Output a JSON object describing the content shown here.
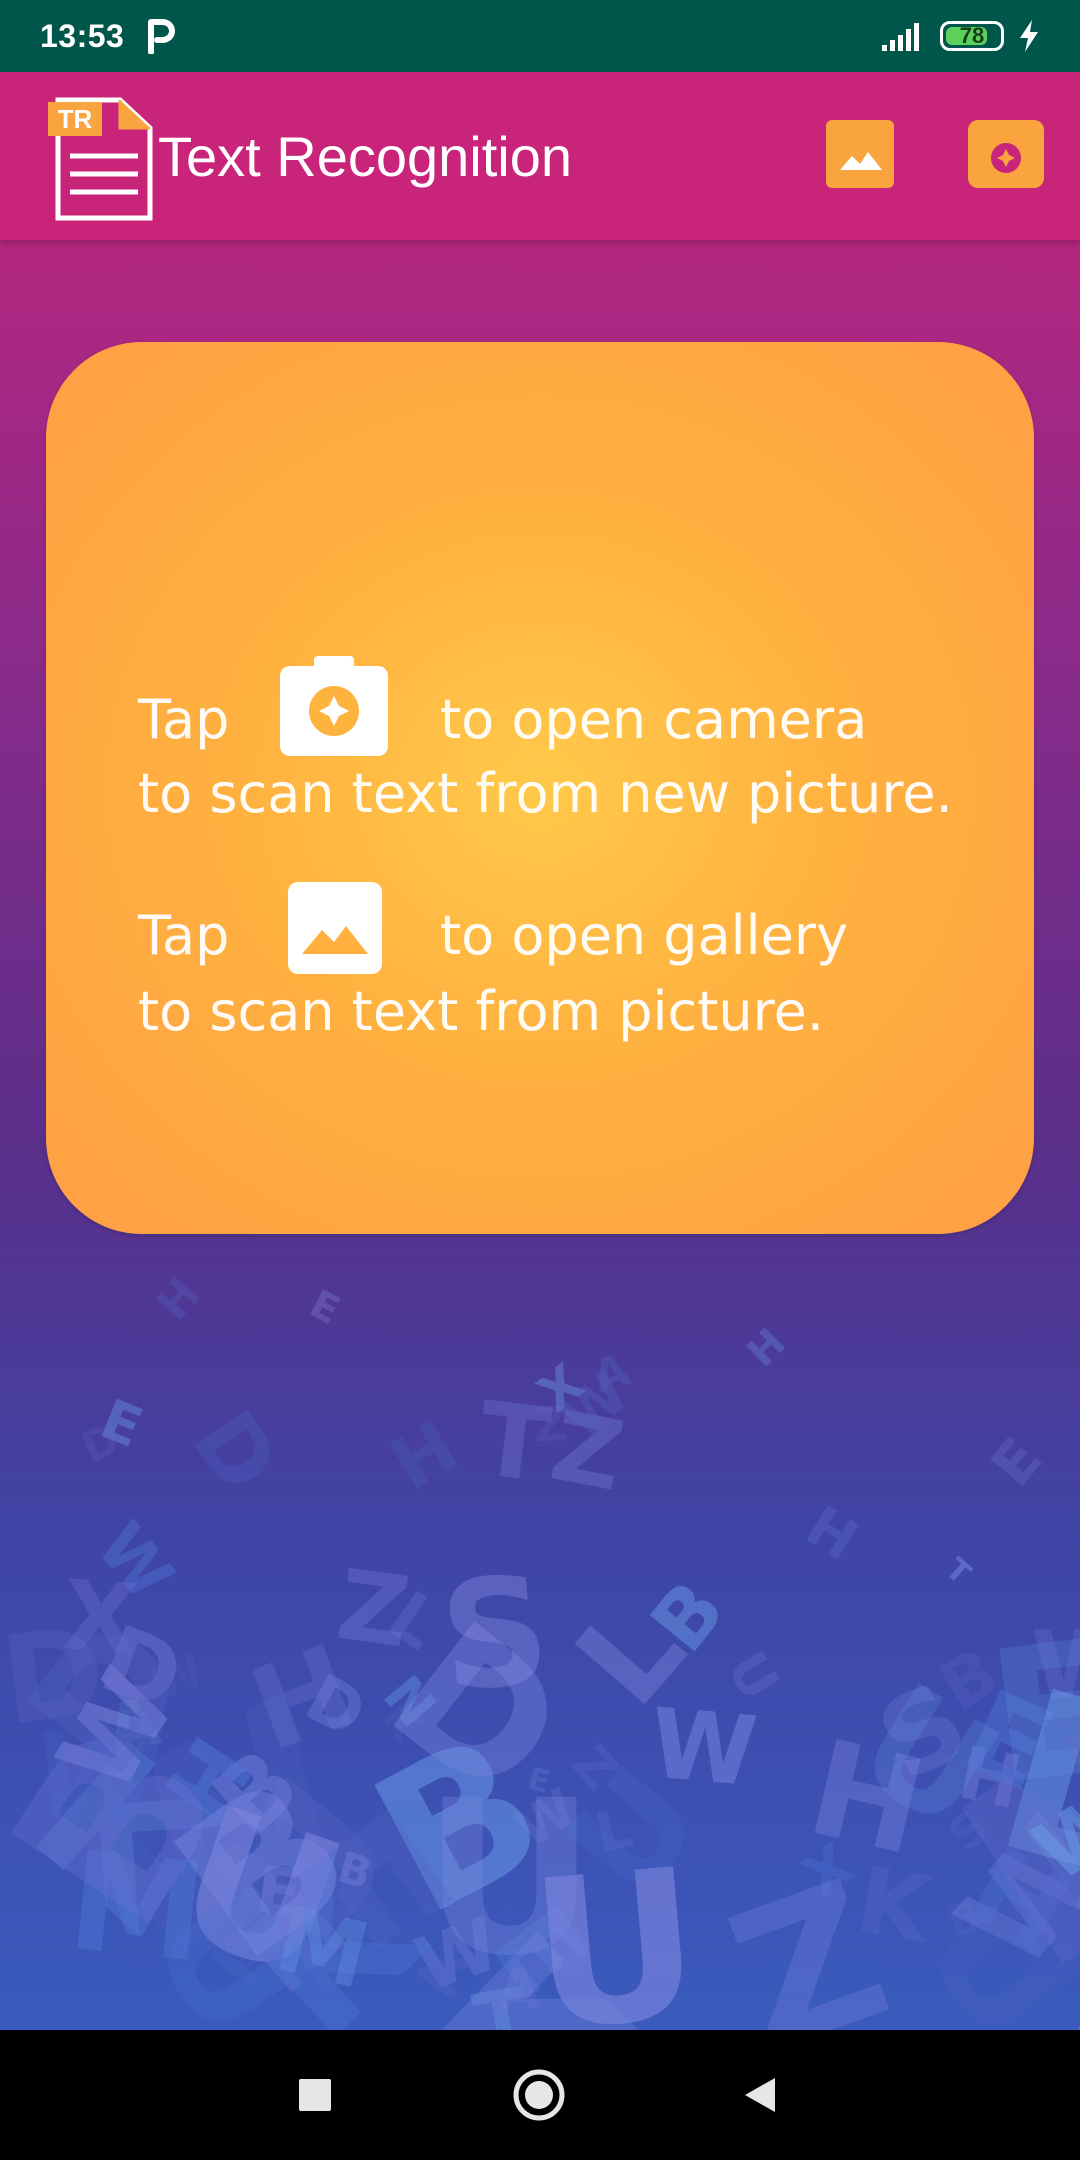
{
  "status": {
    "time": "13:53",
    "battery": "78",
    "battery_level": 0.78
  },
  "toolbar": {
    "title": "Text Recognition",
    "logo_badge": "TR"
  },
  "card": {
    "camera_tap": "Tap",
    "camera_action": "to open camera",
    "camera_desc": "to scan text from new picture.",
    "gallery_tap": "Tap",
    "gallery_action": "to open gallery",
    "gallery_desc": "to scan text from picture."
  },
  "colors": {
    "status_bar": "#00564b",
    "toolbar": "#c8247a",
    "accent": "#f9a43e",
    "card_center": "#ffc94a",
    "card_edge": "#ff9f45"
  },
  "icons": {
    "gallery": "image-icon",
    "camera": "camera-icon",
    "nav_recents": "square-icon",
    "nav_home": "circle-icon",
    "nav_back": "triangle-back-icon"
  },
  "background_letters": [
    "W",
    "Z",
    "U",
    "E",
    "D",
    "T",
    "U",
    "B",
    "K",
    "H",
    "X",
    "E",
    "W",
    "S",
    "H",
    "M",
    "A",
    "B",
    "D",
    "E",
    "W",
    "U",
    "N",
    "K",
    "Z",
    "L",
    "H",
    "W",
    "E",
    "B",
    "D"
  ]
}
